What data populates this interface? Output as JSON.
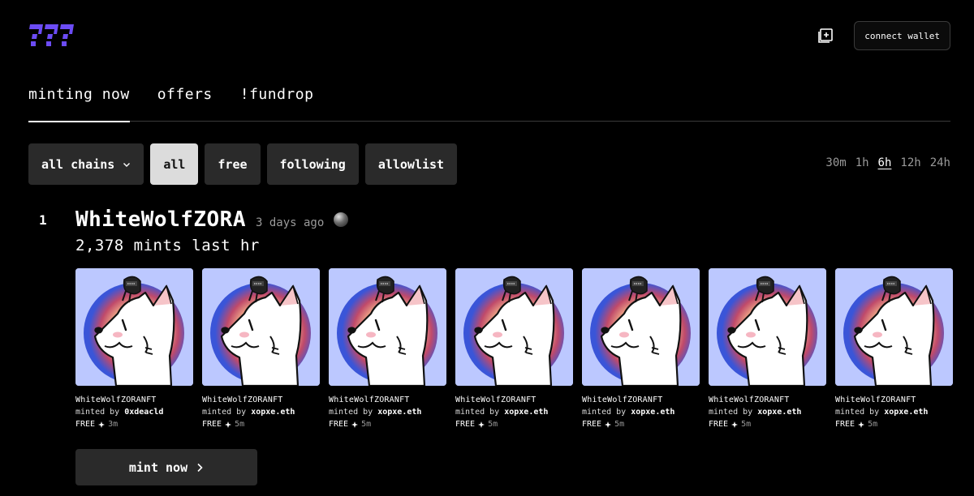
{
  "header": {
    "logo_icon": "brand-logo-icon",
    "create_icon": "create-plus-icon",
    "connect_wallet_label": "connect wallet",
    "brand_color": "#6c4cf5"
  },
  "tabs": [
    {
      "label": "minting now",
      "active": true
    },
    {
      "label": "offers",
      "active": false
    },
    {
      "label": "!fundrop",
      "active": false
    }
  ],
  "filters": {
    "chain_select": "all chains",
    "options": [
      {
        "label": "all",
        "selected": true
      },
      {
        "label": "free",
        "selected": false
      },
      {
        "label": "following",
        "selected": false
      },
      {
        "label": "allowlist",
        "selected": false
      }
    ]
  },
  "time_ranges": [
    {
      "label": "30m",
      "active": false
    },
    {
      "label": "1h",
      "active": false
    },
    {
      "label": "6h",
      "active": true
    },
    {
      "label": "12h",
      "active": false
    },
    {
      "label": "24h",
      "active": false
    }
  ],
  "collection": {
    "rank": "1",
    "name": "WhiteWolfZORA",
    "age": "3 days ago",
    "mints": "2,378 mints last hr",
    "mint_button": "mint now",
    "cards": [
      {
        "name": "WhiteWolfZORANFT",
        "minted_by_prefix": "minted by",
        "minter": "0xdeacld",
        "price": "FREE",
        "age": "3m"
      },
      {
        "name": "WhiteWolfZORANFT",
        "minted_by_prefix": "minted by",
        "minter": "xopxe.eth",
        "price": "FREE",
        "age": "5m"
      },
      {
        "name": "WhiteWolfZORANFT",
        "minted_by_prefix": "minted by",
        "minter": "xopxe.eth",
        "price": "FREE",
        "age": "5m"
      },
      {
        "name": "WhiteWolfZORANFT",
        "minted_by_prefix": "minted by",
        "minter": "xopxe.eth",
        "price": "FREE",
        "age": "5m"
      },
      {
        "name": "WhiteWolfZORANFT",
        "minted_by_prefix": "minted by",
        "minter": "xopxe.eth",
        "price": "FREE",
        "age": "5m"
      },
      {
        "name": "WhiteWolfZORANFT",
        "minted_by_prefix": "minted by",
        "minter": "xopxe.eth",
        "price": "FREE",
        "age": "5m"
      },
      {
        "name": "WhiteWolfZORANFT",
        "minted_by_prefix": "minted by",
        "minter": "xopxe.eth",
        "price": "FREE",
        "age": "5m"
      }
    ]
  }
}
